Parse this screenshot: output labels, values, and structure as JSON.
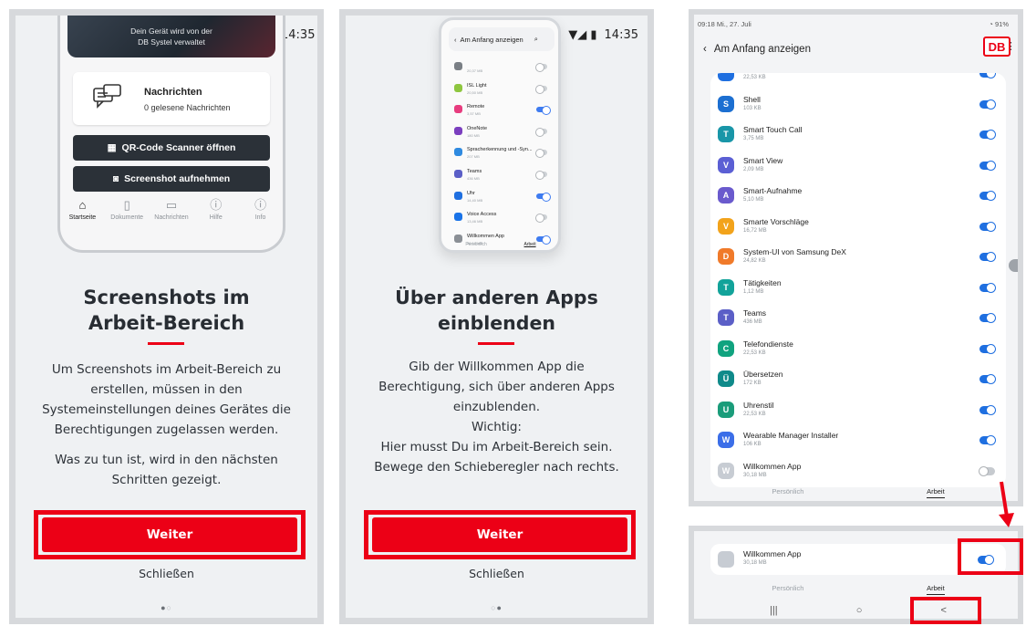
{
  "panel1": {
    "status_time": "14:35",
    "banner_line1": "Dein Gerät wird von der",
    "banner_line2": "DB Systel verwaltet",
    "messages_title": "Nachrichten",
    "messages_sub": "0 gelesene Nachrichten",
    "qr_button": "QR-Code Scanner öffnen",
    "screenshot_button": "Screenshot aufnehmen",
    "nav": [
      "Startseite",
      "Dokumente",
      "Nachrichten",
      "Hilfe",
      "Info"
    ],
    "headline1": "Screenshots im",
    "headline2": "Arbeit-Bereich",
    "body": [
      "Um Screenshots im Arbeit-Bereich zu",
      "erstellen, müssen in den",
      "Systemeinstellungen deines Gerätes die",
      "Berechtigungen zugelassen werden.",
      "",
      "Was zu tun ist, wird in den nächsten",
      "Schritten gezeigt."
    ],
    "cta": "Weiter",
    "close": "Schließen"
  },
  "panel2": {
    "status_time": "14:35",
    "mini_title": "Am Anfang anzeigen",
    "mini_rows": [
      {
        "name": "",
        "sub": "20,37 MB",
        "on": false,
        "color": "#7a7f85"
      },
      {
        "name": "ISL Light",
        "sub": "20,50 MB",
        "on": false,
        "color": "#8ec63f"
      },
      {
        "name": "Remote",
        "sub": "3,57 MB",
        "on": true,
        "color": "#e73c7e"
      },
      {
        "name": "OneNote",
        "sub": "180 MB",
        "on": false,
        "color": "#7b3fbf"
      },
      {
        "name": "Spracherkennung und -Syn...",
        "sub": "207 MB",
        "on": false,
        "color": "#2f8ae0"
      },
      {
        "name": "Teams",
        "sub": "436 MB",
        "on": false,
        "color": "#5b5fc7"
      },
      {
        "name": "Uhr",
        "sub": "14,40 MB",
        "on": true,
        "color": "#1f6fe0"
      },
      {
        "name": "Voice Access",
        "sub": "13,46 MB",
        "on": false,
        "color": "#1a73e8"
      },
      {
        "name": "Willkommen App",
        "sub": "30,18 MB",
        "on": true,
        "color": "#8a8f95"
      }
    ],
    "mini_tabs": [
      "Persönlich",
      "Arbeit"
    ],
    "headline1": "Über anderen Apps",
    "headline2": "einblenden",
    "body": [
      "Gib der Willkommen App die",
      "Berechtigung, sich über anderen Apps",
      "einzublenden.",
      "Wichtig:",
      "Hier musst Du im Arbeit-Bereich sein.",
      "Bewege den Schieberegler nach rechts."
    ],
    "cta": "Weiter",
    "close": "Schließen"
  },
  "panel3": {
    "status_left": "09:18  Mi., 27. Juli",
    "status_right": "91%",
    "title": "Am Anfang anzeigen",
    "logo": "DB",
    "apps": [
      {
        "name": "",
        "size": "22,53 KB",
        "on": true,
        "color": "#1f6fe0",
        "glyph": ""
      },
      {
        "name": "Shell",
        "size": "103 KB",
        "on": true,
        "color": "#1c6fd1",
        "glyph": "S"
      },
      {
        "name": "Smart Touch Call",
        "size": "3,75 MB",
        "on": true,
        "color": "#1996a8",
        "glyph": "T"
      },
      {
        "name": "Smart View",
        "size": "2,09 MB",
        "on": true,
        "color": "#5b5fd4",
        "glyph": "V"
      },
      {
        "name": "Smart-Aufnahme",
        "size": "5,10 MB",
        "on": true,
        "color": "#6a5acd",
        "glyph": "A"
      },
      {
        "name": "Smarte Vorschläge",
        "size": "16,72 MB",
        "on": true,
        "color": "#f2a31b",
        "glyph": "V"
      },
      {
        "name": "System-UI von Samsung DeX",
        "size": "24,82 KB",
        "on": true,
        "color": "#f07a2a",
        "glyph": "D"
      },
      {
        "name": "Tätigkeiten",
        "size": "1,12 MB",
        "on": true,
        "color": "#12a39a",
        "glyph": "T"
      },
      {
        "name": "Teams",
        "size": "436 MB",
        "on": true,
        "color": "#5b5fc7",
        "glyph": "T"
      },
      {
        "name": "Telefondienste",
        "size": "22,53 KB",
        "on": true,
        "color": "#10a37f",
        "glyph": "C"
      },
      {
        "name": "Übersetzen",
        "size": "172 KB",
        "on": true,
        "color": "#0f8a8a",
        "glyph": "Ü"
      },
      {
        "name": "Uhrenstil",
        "size": "22,53 KB",
        "on": true,
        "color": "#1a9c7a",
        "glyph": "U"
      },
      {
        "name": "Wearable Manager Installer",
        "size": "106 KB",
        "on": true,
        "color": "#3b6ee8",
        "glyph": "W"
      },
      {
        "name": "Willkommen App",
        "size": "30,18 MB",
        "on": false,
        "color": "#c7ccd3",
        "glyph": "W"
      }
    ],
    "tabs": [
      "Persönlich",
      "Arbeit"
    ]
  },
  "panel4": {
    "app_name": "Willkommen App",
    "app_size": "30,18 MB",
    "toggle_on": true,
    "tabs": [
      "Persönlich",
      "Arbeit"
    ],
    "nav": [
      "|||",
      "○",
      "<"
    ]
  },
  "colors": {
    "accent": "#ec0016",
    "toggle_on": "#1f6fe0"
  }
}
